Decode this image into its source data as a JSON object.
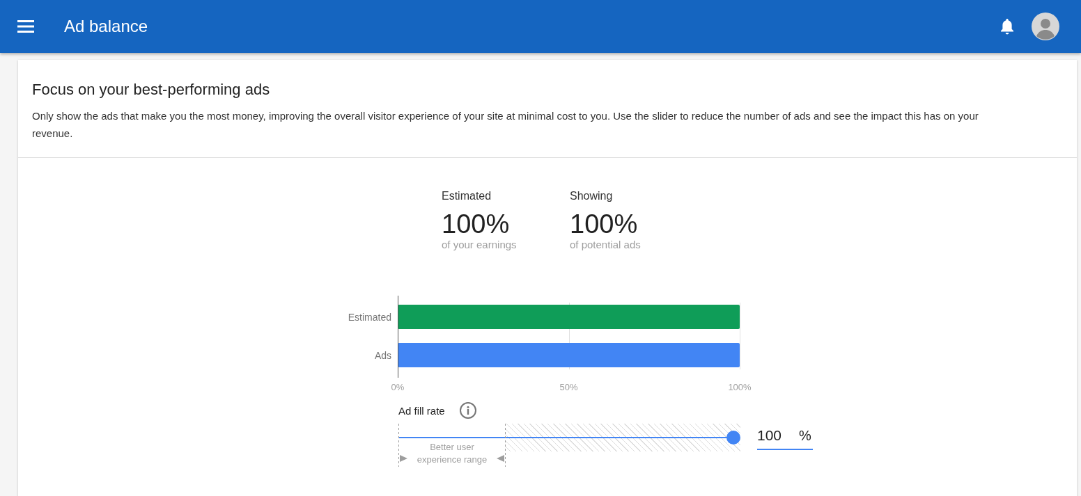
{
  "app_bar": {
    "title": "Ad balance"
  },
  "card": {
    "title": "Focus on your best-performing ads",
    "description": "Only show the ads that make you the most money, improving the overall visitor experience of your site at minimal cost to you. Use the slider to reduce the number of ads and see the impact this has on your revenue."
  },
  "stats": [
    {
      "label": "Estimated",
      "value": "100%",
      "caption": "of your earnings"
    },
    {
      "label": "Showing",
      "value": "100%",
      "caption": "of potential ads"
    }
  ],
  "chart_data": {
    "type": "bar",
    "orientation": "horizontal",
    "stacked": false,
    "series": [
      {
        "name": "Estimated",
        "color": "#0f9d58",
        "values": [
          100
        ]
      },
      {
        "name": "Ads",
        "color": "#4285f4",
        "values": [
          100
        ]
      }
    ],
    "xlim": [
      0,
      100
    ],
    "xticks": [
      {
        "value": 0,
        "label": "0%"
      },
      {
        "value": 50,
        "label": "50%"
      },
      {
        "value": 100,
        "label": "100%"
      }
    ]
  },
  "fill_rate": {
    "label": "Ad fill rate",
    "level": 1.0,
    "range_label": "Better user experience range",
    "value": "100",
    "unit": "%"
  }
}
